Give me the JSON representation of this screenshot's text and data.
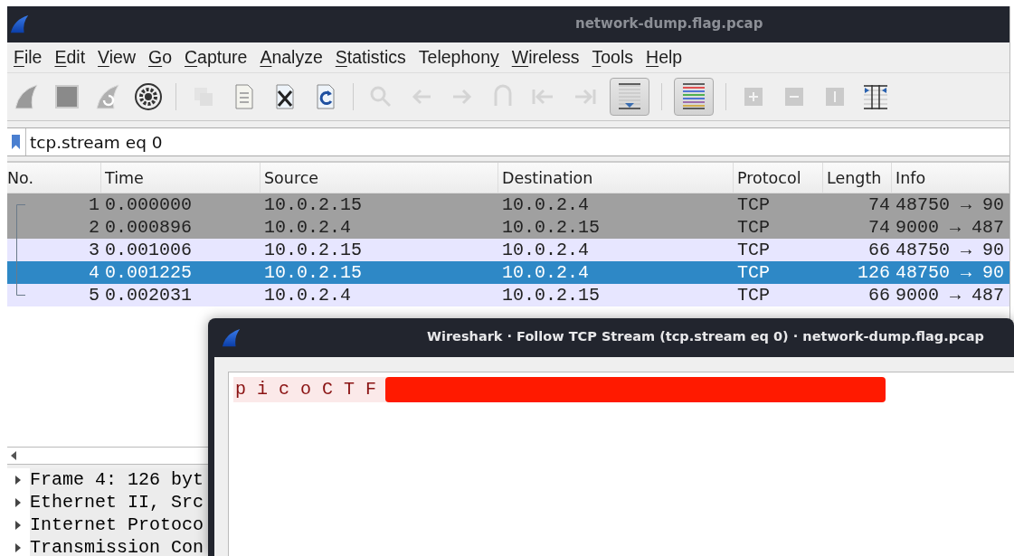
{
  "window": {
    "title": "network-dump.flag.pcap"
  },
  "menu": [
    {
      "key": "F",
      "post": "ile"
    },
    {
      "key": "E",
      "post": "dit"
    },
    {
      "key": "V",
      "post": "iew"
    },
    {
      "key": "G",
      "post": "o"
    },
    {
      "key": "C",
      "post": "apture"
    },
    {
      "key": "A",
      "post": "nalyze"
    },
    {
      "key": "S",
      "post": "tatistics"
    },
    {
      "pre": "Telephon",
      "key": "y"
    },
    {
      "key": "W",
      "post": "ireless"
    },
    {
      "key": "T",
      "post": "ools"
    },
    {
      "key": "H",
      "post": "elp"
    }
  ],
  "toolbar": [
    {
      "kind": "button",
      "disabled": false,
      "on": false
    },
    {
      "kind": "button",
      "disabled": false,
      "on": false
    },
    {
      "kind": "button",
      "disabled": false,
      "on": false
    },
    {
      "kind": "button",
      "disabled": false,
      "on": false
    },
    {
      "kind": "separator"
    },
    {
      "kind": "button",
      "disabled": true,
      "on": false
    },
    {
      "kind": "button",
      "disabled": false,
      "on": false
    },
    {
      "kind": "button",
      "disabled": false,
      "on": false
    },
    {
      "kind": "button",
      "disabled": false,
      "on": false
    },
    {
      "kind": "separator"
    },
    {
      "kind": "button",
      "disabled": true,
      "on": false
    },
    {
      "kind": "button",
      "disabled": true,
      "on": false
    },
    {
      "kind": "button",
      "disabled": true,
      "on": false
    },
    {
      "kind": "button",
      "disabled": true,
      "on": false
    },
    {
      "kind": "button",
      "disabled": true,
      "on": false
    },
    {
      "kind": "button",
      "disabled": true,
      "on": false
    },
    {
      "kind": "button",
      "disabled": false,
      "on": true
    },
    {
      "kind": "separator"
    },
    {
      "kind": "button",
      "disabled": false,
      "on": true
    },
    {
      "kind": "separator"
    },
    {
      "kind": "button",
      "disabled": true,
      "on": false
    },
    {
      "kind": "button",
      "disabled": true,
      "on": false
    },
    {
      "kind": "button",
      "disabled": true,
      "on": false
    },
    {
      "kind": "button",
      "disabled": false,
      "on": false
    }
  ],
  "filter": {
    "value": "tcp.stream eq 0"
  },
  "packet_list": {
    "columns": [
      "No.",
      "Time",
      "Source",
      "Destination",
      "Protocol",
      "Length",
      "Info"
    ],
    "rows": [
      {
        "cells": [
          "1",
          "0.000000",
          "10.0.2.15",
          "10.0.2.4",
          "TCP",
          "74",
          "48750 → 90"
        ],
        "selected": false,
        "color": "#a0a0a0"
      },
      {
        "cells": [
          "2",
          "0.000896",
          "10.0.2.4",
          "10.0.2.15",
          "TCP",
          "74",
          "9000 → 487"
        ],
        "selected": false,
        "color": "#a0a0a0"
      },
      {
        "cells": [
          "3",
          "0.001006",
          "10.0.2.15",
          "10.0.2.4",
          "TCP",
          "66",
          "48750 → 90"
        ],
        "selected": false,
        "color": "#e7e6ff"
      },
      {
        "cells": [
          "4",
          "0.001225",
          "10.0.2.15",
          "10.0.2.4",
          "TCP",
          "126",
          "48750 → 90"
        ],
        "selected": true
      },
      {
        "cells": [
          "5",
          "0.002031",
          "10.0.2.4",
          "10.0.2.15",
          "TCP",
          "66",
          "9000 → 487"
        ],
        "selected": false,
        "color": "#e7e6ff"
      }
    ]
  },
  "details": [
    {
      "label": "Frame 4: 126 byt",
      "expanded": false
    },
    {
      "label": "Ethernet II, Src",
      "expanded": false
    },
    {
      "label": "Internet Protoco",
      "expanded": false
    },
    {
      "label": "Transmission Con",
      "expanded": false
    }
  ],
  "dialog": {
    "title": "Wireshark · Follow TCP Stream (tcp.stream eq 0) · network-dump.flag.pcap",
    "stream_text": "p i c o C T F",
    "redacted": true
  }
}
